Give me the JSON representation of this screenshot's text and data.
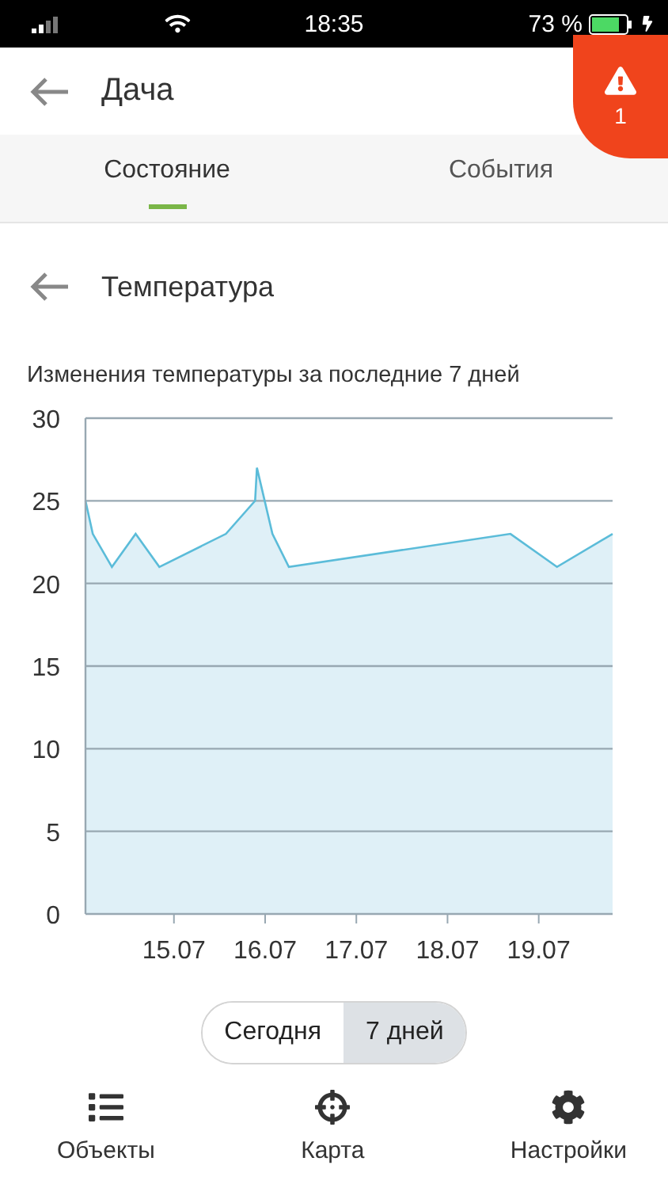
{
  "status_bar": {
    "time": "18:35",
    "battery": "73 %"
  },
  "header": {
    "title": "Дача",
    "alert_count": "1"
  },
  "tabs": [
    {
      "label": "Состояние",
      "selected": true
    },
    {
      "label": "События",
      "selected": false
    }
  ],
  "section": {
    "title": "Температура"
  },
  "chart": {
    "caption": "Изменения температуры за последние 7 дней",
    "chart_data": {
      "type": "area",
      "grid": true,
      "x": [
        14.1,
        14.18,
        14.39,
        14.65,
        14.91,
        15.64,
        15.96,
        15.98,
        16.15,
        16.33,
        18.76,
        19.27,
        19.88
      ],
      "series": [
        {
          "color": "#5bbcd9",
          "values": [
            25,
            23,
            21,
            23,
            21,
            23,
            25,
            27,
            23,
            21,
            23,
            21,
            23
          ]
        }
      ],
      "xlim": [
        14.1,
        19.88
      ],
      "ylim": [
        0,
        30
      ],
      "xticks": [
        {
          "value": 15.07,
          "label": "15.07"
        },
        {
          "value": 16.07,
          "label": "16.07"
        },
        {
          "value": 17.07,
          "label": "17.07"
        },
        {
          "value": 18.07,
          "label": "18.07"
        },
        {
          "value": 19.07,
          "label": "19.07"
        }
      ],
      "yticks": [
        0,
        5,
        10,
        15,
        20,
        25,
        30
      ]
    }
  },
  "range": [
    {
      "label": "Сегодня",
      "selected": false
    },
    {
      "label": "7 дней",
      "selected": true
    }
  ],
  "nav": [
    {
      "kind": "list",
      "label": "Объекты"
    },
    {
      "kind": "target",
      "label": "Карта"
    },
    {
      "kind": "gear",
      "label": "Настройки"
    }
  ]
}
